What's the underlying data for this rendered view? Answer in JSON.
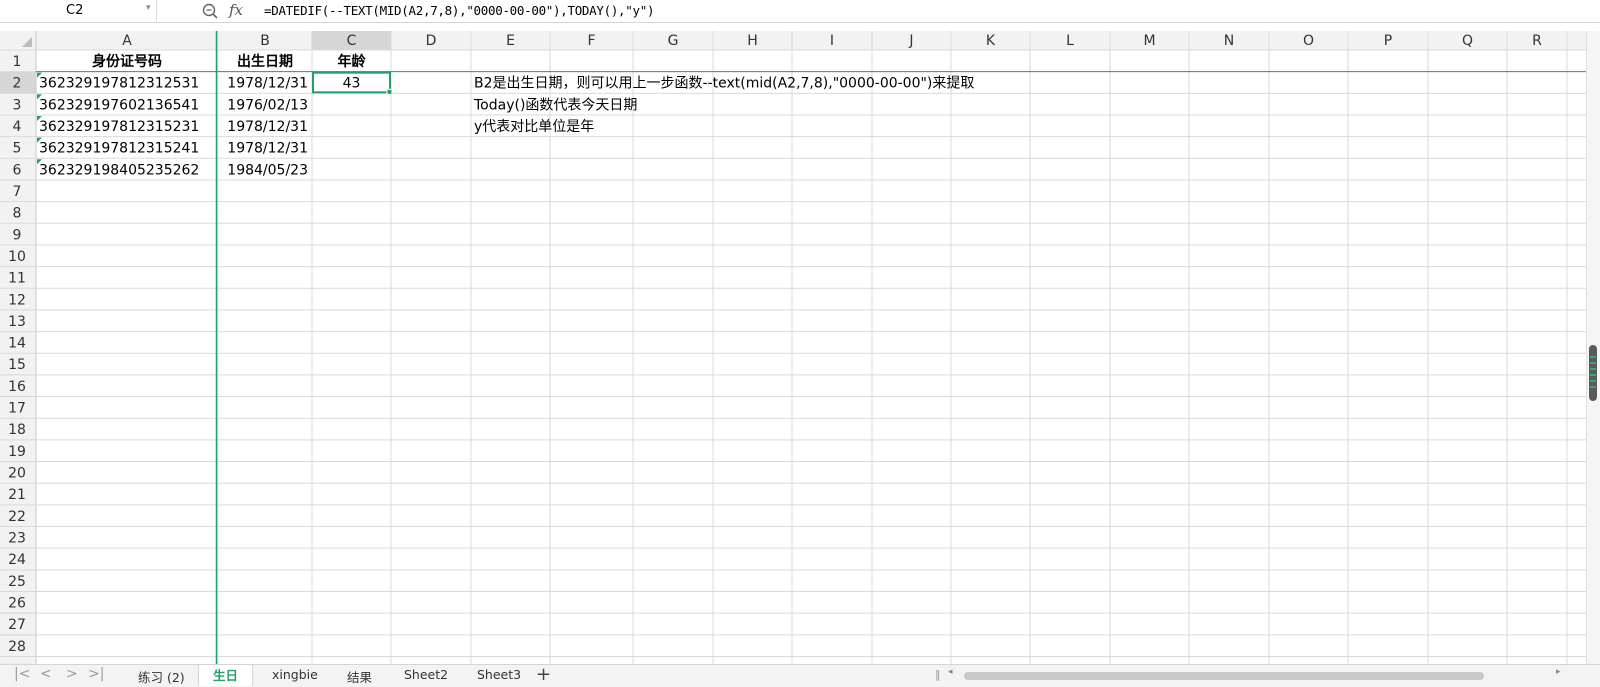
{
  "name_box": {
    "value": "C2"
  },
  "formula_bar": {
    "formula": "=DATEDIF(--TEXT(MID(A2,7,8),\"0000-00-00\"),TODAY(),\"y\")"
  },
  "columns": [
    "A",
    "B",
    "C",
    "D",
    "E",
    "F",
    "G",
    "H",
    "I",
    "J",
    "K",
    "L",
    "M",
    "N",
    "O",
    "P",
    "Q",
    "R"
  ],
  "rows": [
    "1",
    "2",
    "3",
    "4",
    "5",
    "6",
    "7",
    "8",
    "9",
    "10",
    "11",
    "12",
    "13",
    "14",
    "15",
    "16",
    "17",
    "18",
    "19",
    "20",
    "21",
    "22",
    "23",
    "24",
    "25",
    "26",
    "27",
    "28"
  ],
  "selected_cell": "C2",
  "cells": {
    "A1": "身份证号码",
    "B1": "出生日期",
    "C1": "年龄",
    "A2": "362329197812312531",
    "B2": "1978/12/31",
    "C2": "43",
    "A3": "362329197602136541",
    "B3": "1976/02/13",
    "A4": "362329197812315231",
    "B4": "1978/12/31",
    "A5": "362329197812315241",
    "B5": "1978/12/31",
    "A6": "362329198405235262",
    "B6": "1984/05/23",
    "E2": "B2是出生日期，则可以用上一步函数--text(mid(A2,7,8),\"0000-00-00\")来提取",
    "E3": "Today()函数代表今天日期",
    "E4": "y代表对比单位是年"
  },
  "sheet_tabs": [
    {
      "label": "练习 (2)",
      "active": false
    },
    {
      "label": "生日",
      "active": true
    },
    {
      "label": "xingbie",
      "active": false
    },
    {
      "label": "结果",
      "active": false
    },
    {
      "label": "Sheet2",
      "active": false
    },
    {
      "label": "Sheet3",
      "active": false
    }
  ],
  "icons": [
    "zoom-icon",
    "fx-icon",
    "chevron-down-icon",
    "first-sheet-icon",
    "prev-sheet-icon",
    "next-sheet-icon",
    "last-sheet-icon",
    "add-sheet-icon"
  ],
  "colors": {
    "accent": "#21a06a",
    "grid": "#d9d9d9",
    "header_bg": "#f2f2f2",
    "selected_header_bg": "#d6d6d6"
  }
}
